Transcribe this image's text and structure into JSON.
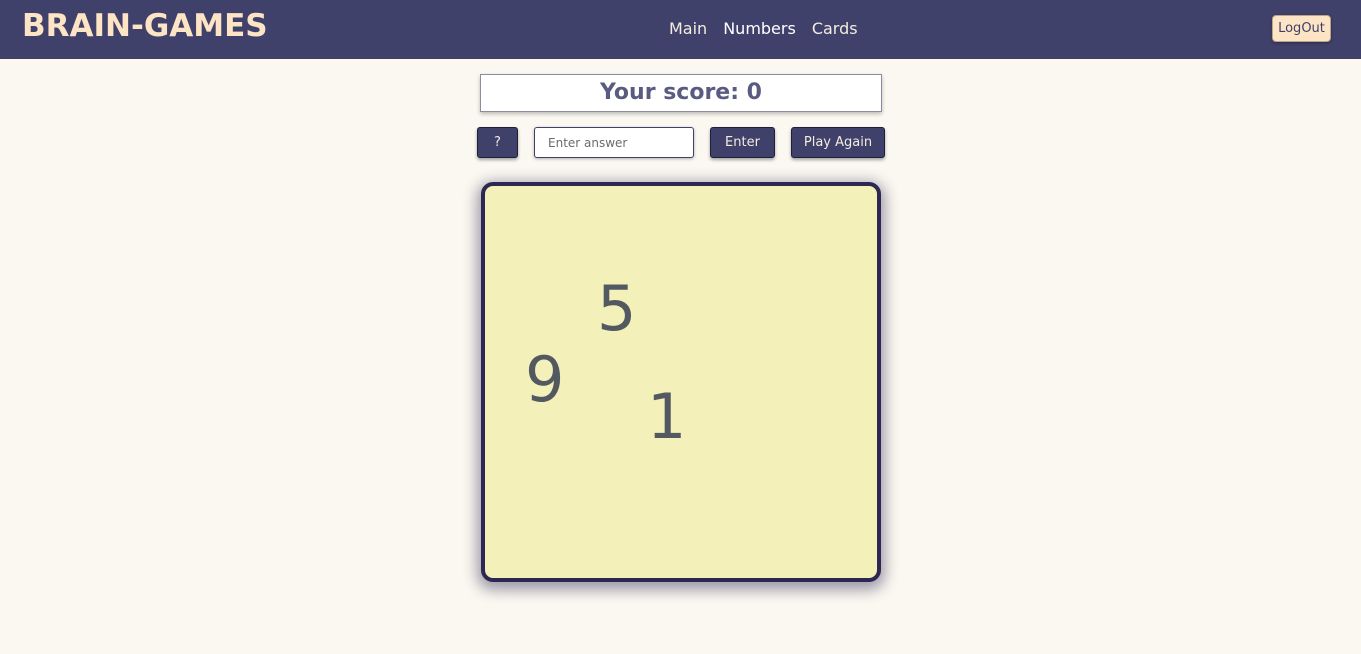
{
  "navbar": {
    "brand": "BRAIN-GAMES",
    "links": [
      {
        "label": "Main"
      },
      {
        "label": "Numbers"
      },
      {
        "label": "Cards"
      }
    ],
    "logout_label": "LogOut"
  },
  "score": {
    "text": "Your score: 0"
  },
  "controls": {
    "help_label": "?",
    "answer_placeholder": "Enter answer",
    "answer_value": "",
    "enter_label": "Enter",
    "play_again_label": "Play Again"
  },
  "board": {
    "numbers": [
      "5",
      "9",
      "1"
    ]
  },
  "colors": {
    "navbar": "#40416b",
    "brand": "#fde4c4",
    "background": "#fbf8f1",
    "board": "#f3f1b9",
    "board_border": "#2c2851"
  }
}
